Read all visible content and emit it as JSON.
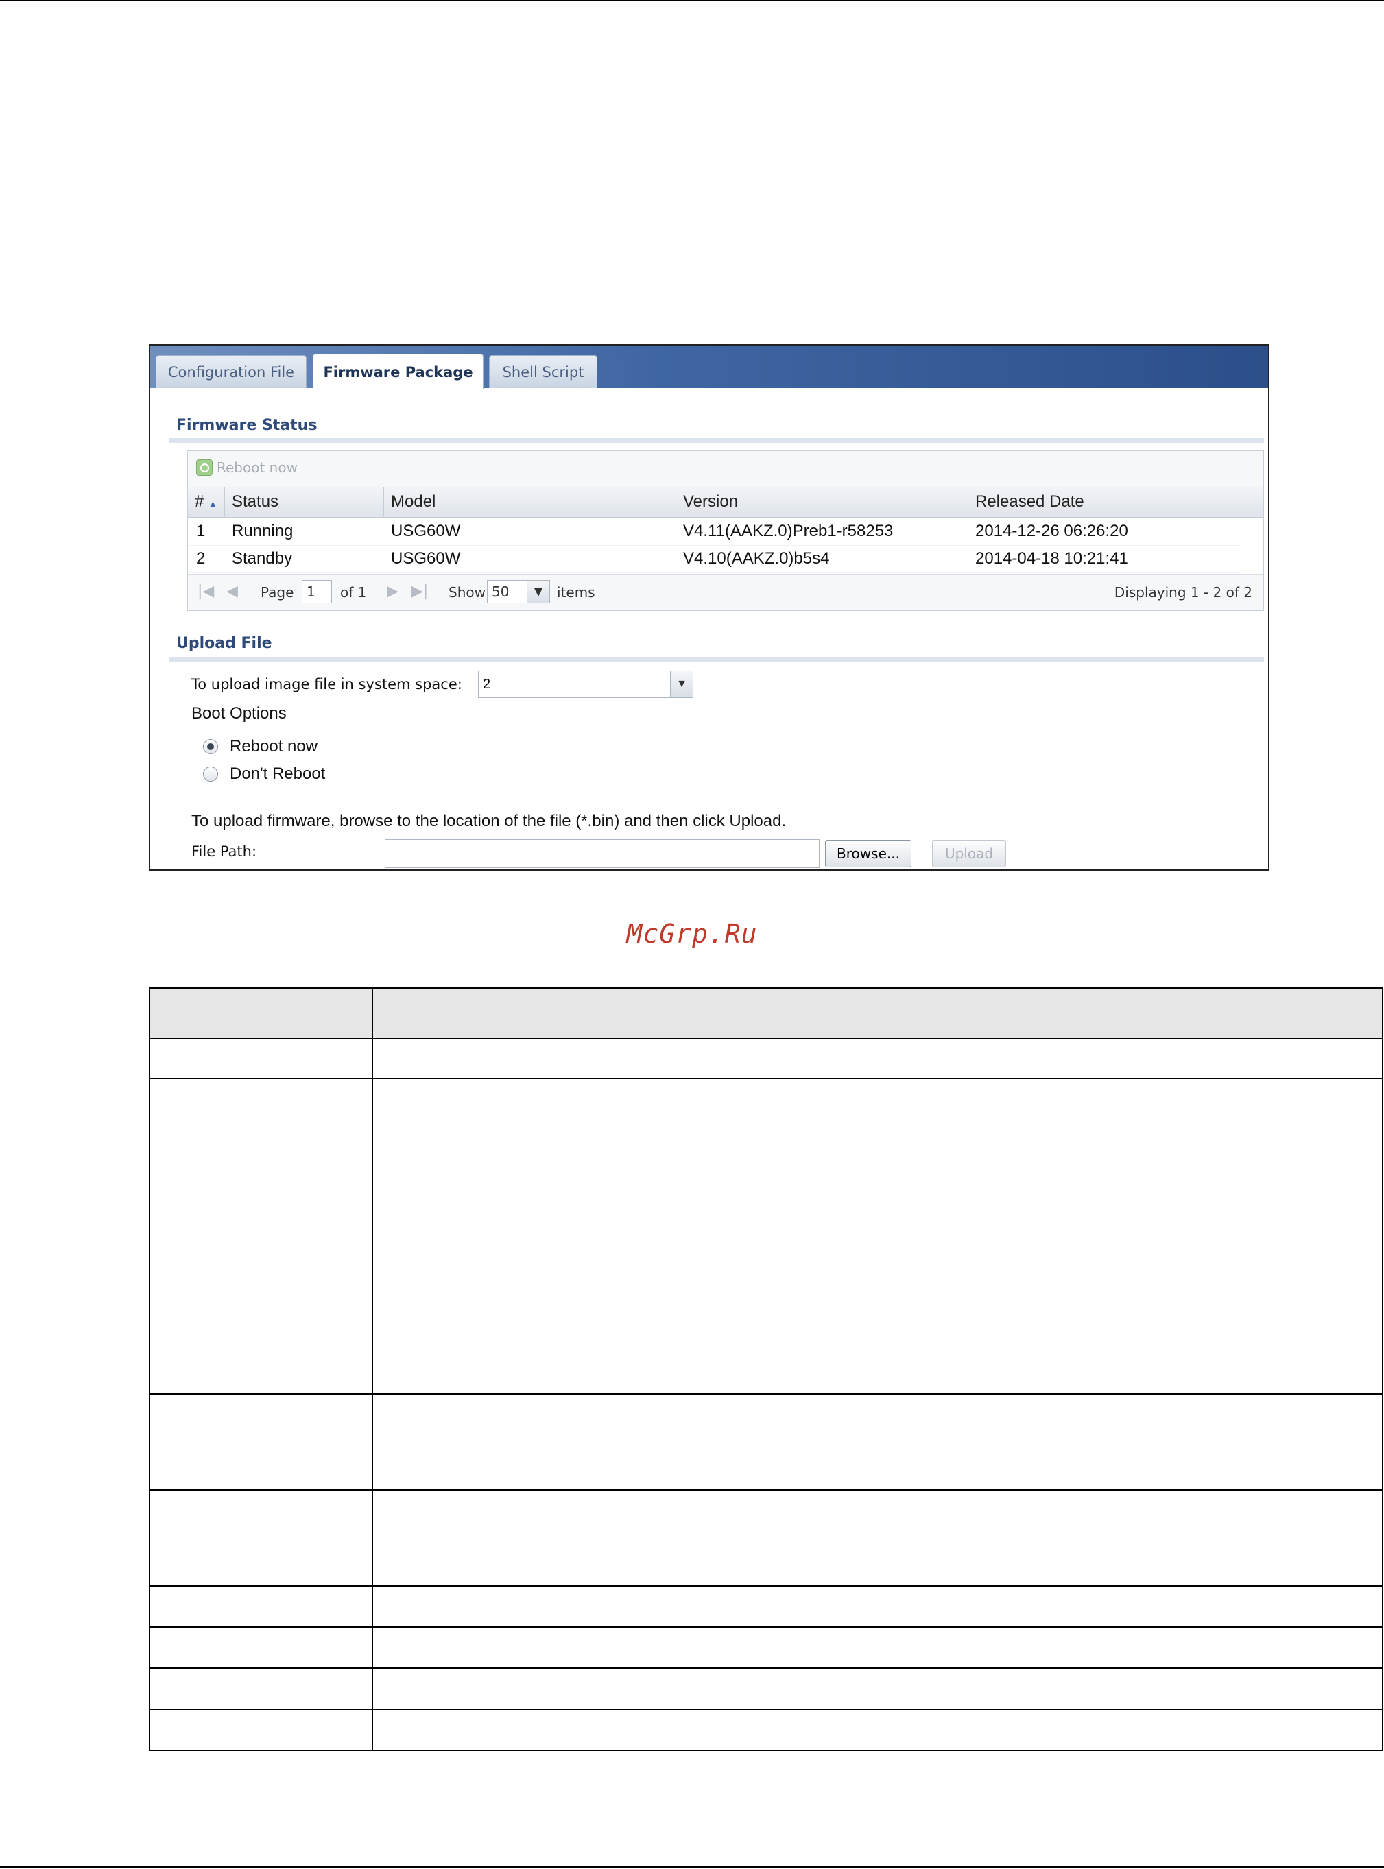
{
  "tabs": [
    {
      "label": "Configuration File",
      "active": false
    },
    {
      "label": "Firmware Package",
      "active": true
    },
    {
      "label": "Shell Script",
      "active": false
    }
  ],
  "firmware_status": {
    "title": "Firmware Status",
    "reboot_label": "Reboot now",
    "columns": [
      "#",
      "Status",
      "Model",
      "Version",
      "Released Date"
    ],
    "rows": [
      {
        "num": "1",
        "status": "Running",
        "model": "USG60W",
        "version": "V4.11(AAKZ.0)Preb1-r58253",
        "date": "2014-12-26 06:26:20"
      },
      {
        "num": "2",
        "status": "Standby",
        "model": "USG60W",
        "version": "V4.10(AAKZ.0)b5s4",
        "date": "2014-04-18 10:21:41"
      }
    ],
    "pager": {
      "page_label": "Page",
      "page_value": "1",
      "of_label": "of 1",
      "show_label": "Show",
      "show_value": "50",
      "items_label": "items",
      "displaying": "Displaying 1 - 2 of 2"
    }
  },
  "upload_file": {
    "title": "Upload File",
    "system_space_label": "To upload image file in system space:",
    "system_space_value": "2",
    "boot_options_label": "Boot Options",
    "boot_options": [
      {
        "label": "Reboot now",
        "selected": true
      },
      {
        "label": "Don't Reboot",
        "selected": false
      }
    ],
    "instruction": "To upload firmware, browse to the location of the file (*.bin) and then click Upload.",
    "file_path_label": "File Path:",
    "file_path_value": "",
    "browse_label": "Browse...",
    "upload_label": "Upload"
  },
  "watermark": "McGrp.Ru",
  "colors": {
    "accent": "#2e4a78",
    "tabbar": "#3f66a3",
    "watermark": "#c0392b"
  }
}
